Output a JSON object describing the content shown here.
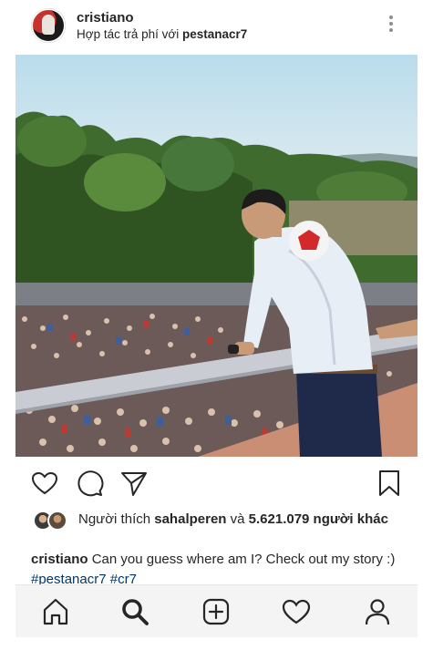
{
  "header": {
    "username": "cristiano",
    "sponsor_prefix": "Hợp tác trả phí với",
    "sponsor_partner": "pestanacr7"
  },
  "post": {
    "likes_prefix": "Người thích",
    "likes_user": "sahalperen",
    "likes_and": "và",
    "likes_count": "5.621.079 người khác",
    "caption_user": "cristiano",
    "caption_text": "Can you guess where am I? Check out my story :)",
    "hashtag1": "#pestanacr7",
    "hashtag2": "#cr7"
  },
  "icons": {
    "actions": [
      "heart-icon",
      "comment-icon",
      "share-icon",
      "bookmark-icon"
    ],
    "nav": [
      "home-icon",
      "search-icon",
      "add-post-icon",
      "activity-icon",
      "profile-icon"
    ]
  },
  "colors": {
    "text": "#262626",
    "hashtag": "#00376b",
    "nav_background": "#f4f4f4"
  }
}
